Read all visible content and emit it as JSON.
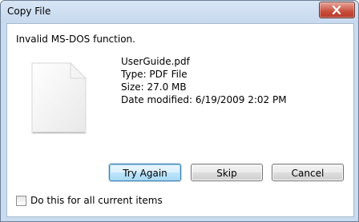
{
  "window": {
    "title": "Copy File"
  },
  "dialog": {
    "message": "Invalid MS-DOS function.",
    "file": {
      "name": "UserGuide.pdf",
      "type": "Type: PDF File",
      "size": "Size: 27.0 MB",
      "date_modified": "Date modified: 6/19/2009 2:02 PM"
    },
    "buttons": {
      "try_again": "Try Again",
      "skip": "Skip",
      "cancel": "Cancel"
    },
    "checkbox": {
      "label": "Do this for all current items",
      "checked": false
    }
  },
  "icons": {
    "close": "close-icon",
    "file": "generic-file-icon"
  },
  "colors": {
    "titlebar": "#c7d9ee",
    "close_button": "#c84d3b",
    "default_button_border": "#3c7fb1"
  }
}
